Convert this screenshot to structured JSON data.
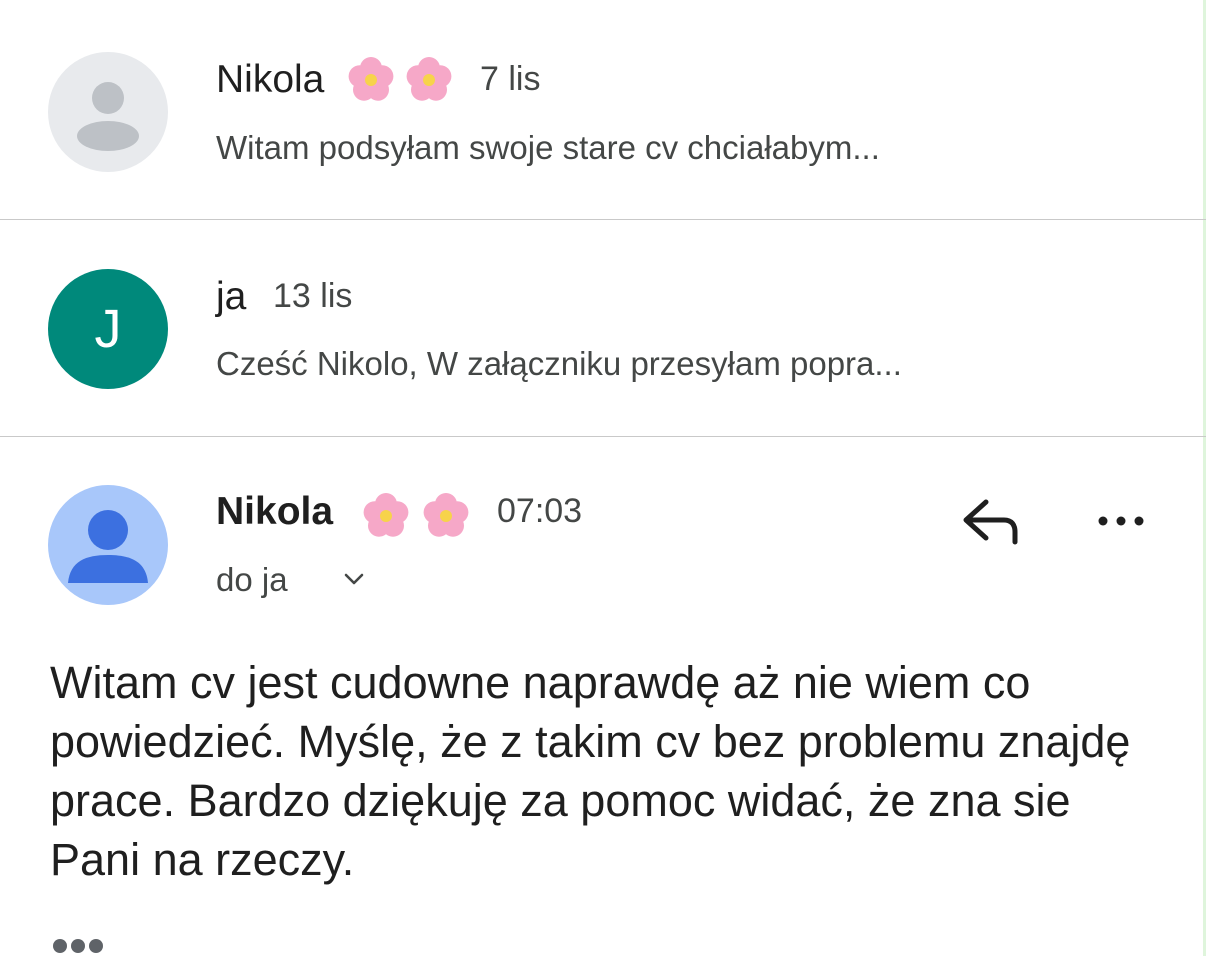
{
  "thread": [
    {
      "sender": "Nikola",
      "date": "7 lis",
      "snippet": "Witam podsyłam swoje stare cv chciałabym...",
      "avatar_icon": "person-icon",
      "avatar_color": "#e8eaed"
    },
    {
      "sender": "ja",
      "date": "13 lis",
      "snippet": "Cześć Nikolo, W załączniku przesyłam popra...",
      "avatar_initial": "J",
      "avatar_color": "#00897b"
    }
  ],
  "open_message": {
    "sender": "Nikola",
    "time": "07:03",
    "to_line": "do ja",
    "avatar_icon": "person-icon",
    "avatar_color": "#a8c7fa",
    "body": "Witam cv jest cudowne naprawdę aż nie wiem co powiedzieć. Myślę, że z takim cv bez problemu znajdę prace. Bardzo dziękuję za pomoc widać, że zna sie Pani na rzeczy.",
    "reply_icon": "reply-icon",
    "more_icon": "more-horizontal-icon",
    "expand_icon": "chevron-down-icon",
    "trimmed_icon": "trimmed-content-icon"
  }
}
